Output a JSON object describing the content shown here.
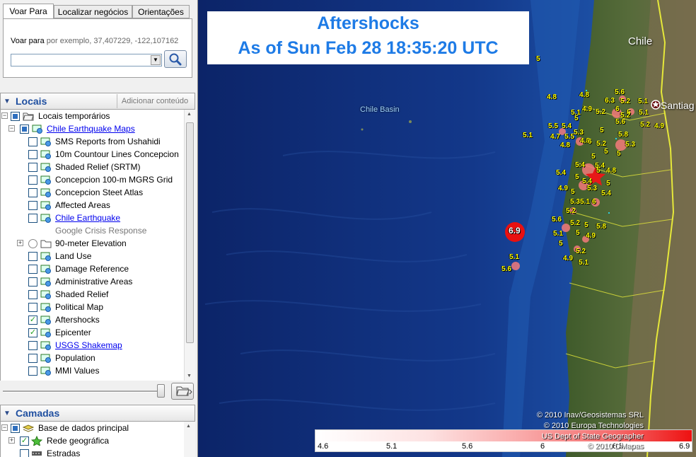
{
  "tabs": [
    "Voar Para",
    "Localizar negócios",
    "Orientações"
  ],
  "fly_to": {
    "label": "Voar para",
    "hint": "por exemplo, 37,407229, -122,107162",
    "value": ""
  },
  "places": {
    "title": "Locais",
    "add_content": "Adicionar conteúdo",
    "items": [
      {
        "label": "Locais temporários",
        "checked": "partial"
      },
      {
        "label": "Chile Earthquake Maps",
        "checked": "partial",
        "link": true
      },
      {
        "label": "SMS Reports from Ushahidi",
        "checked": false
      },
      {
        "label": "10m Countour Lines Concepcion",
        "checked": false
      },
      {
        "label": "Shaded Relief (SRTM)",
        "checked": false
      },
      {
        "label": "Concepcion 100-m MGRS Grid",
        "checked": false
      },
      {
        "label": "Concepcion Steet Atlas",
        "checked": false
      },
      {
        "label": "Affected Areas",
        "checked": false
      },
      {
        "label": "Chile Earthquake",
        "checked": false,
        "link": true
      },
      {
        "label": "Google Crisis Response",
        "sub": true
      },
      {
        "label": "90-meter Elevation",
        "checked": false
      },
      {
        "label": "Land Use",
        "checked": false
      },
      {
        "label": "Damage Reference",
        "checked": false
      },
      {
        "label": "Administrative Areas",
        "checked": false
      },
      {
        "label": "Shaded Relief",
        "checked": false
      },
      {
        "label": "Political Map",
        "checked": false
      },
      {
        "label": "Aftershocks",
        "checked": true
      },
      {
        "label": "Epicenter",
        "checked": true
      },
      {
        "label": "USGS Shakemap",
        "checked": false,
        "link": true
      },
      {
        "label": "Population",
        "checked": false
      },
      {
        "label": "MMI Values",
        "checked": false
      }
    ]
  },
  "layers": {
    "title": "Camadas",
    "items": [
      {
        "label": "Base de dados principal",
        "checked": "partial"
      },
      {
        "label": "Rede geográfica",
        "checked": true
      },
      {
        "label": "Estradas",
        "checked": false
      }
    ]
  },
  "map": {
    "title_line1": "Aftershocks",
    "title_line2": "As of Sun Feb 28 18:35:20 UTC",
    "basin_label": "Chile Basin",
    "country_label": "Chile",
    "city_label": "Santiag",
    "copyrights": [
      "© 2010 Inav/Geosistemas SRL",
      "© 2010 Europa Technologies",
      "US Dept of State Geographer",
      "© 2010 DMapas"
    ],
    "legend_ticks": [
      "4.6",
      "5.1",
      "5.6",
      "6",
      "6.5",
      "6.9"
    ],
    "magnitude_labels": [
      "5",
      "4.8",
      "4.8",
      "5.6",
      "6.3",
      "5.2",
      "5.1",
      "5.1",
      "4.9",
      "5.2",
      "6",
      "5",
      "5.2",
      "5.1",
      "5",
      "5.2",
      "4.9",
      "5.1",
      "5.6",
      "5",
      "5.5",
      "5.4",
      "5.3",
      "4.7",
      "5.5",
      "5.8",
      "4.8",
      "4.8",
      "6",
      "5.2",
      "5.3",
      "5",
      "5",
      "5",
      "5.4",
      "5.4",
      "5",
      "4.8",
      "5.4",
      "5",
      "5.4",
      "4.9",
      "5",
      "5.3",
      "5.4",
      "5",
      "5.3",
      "5.1",
      "6",
      "5.2",
      "5.6",
      "5.2",
      "5.8",
      "5",
      "5.1",
      "5",
      "4.9",
      "5",
      "5.2",
      "4.9",
      "5.1",
      "6.9",
      "5.1",
      "5.6"
    ],
    "accent": "#1e7be6"
  }
}
